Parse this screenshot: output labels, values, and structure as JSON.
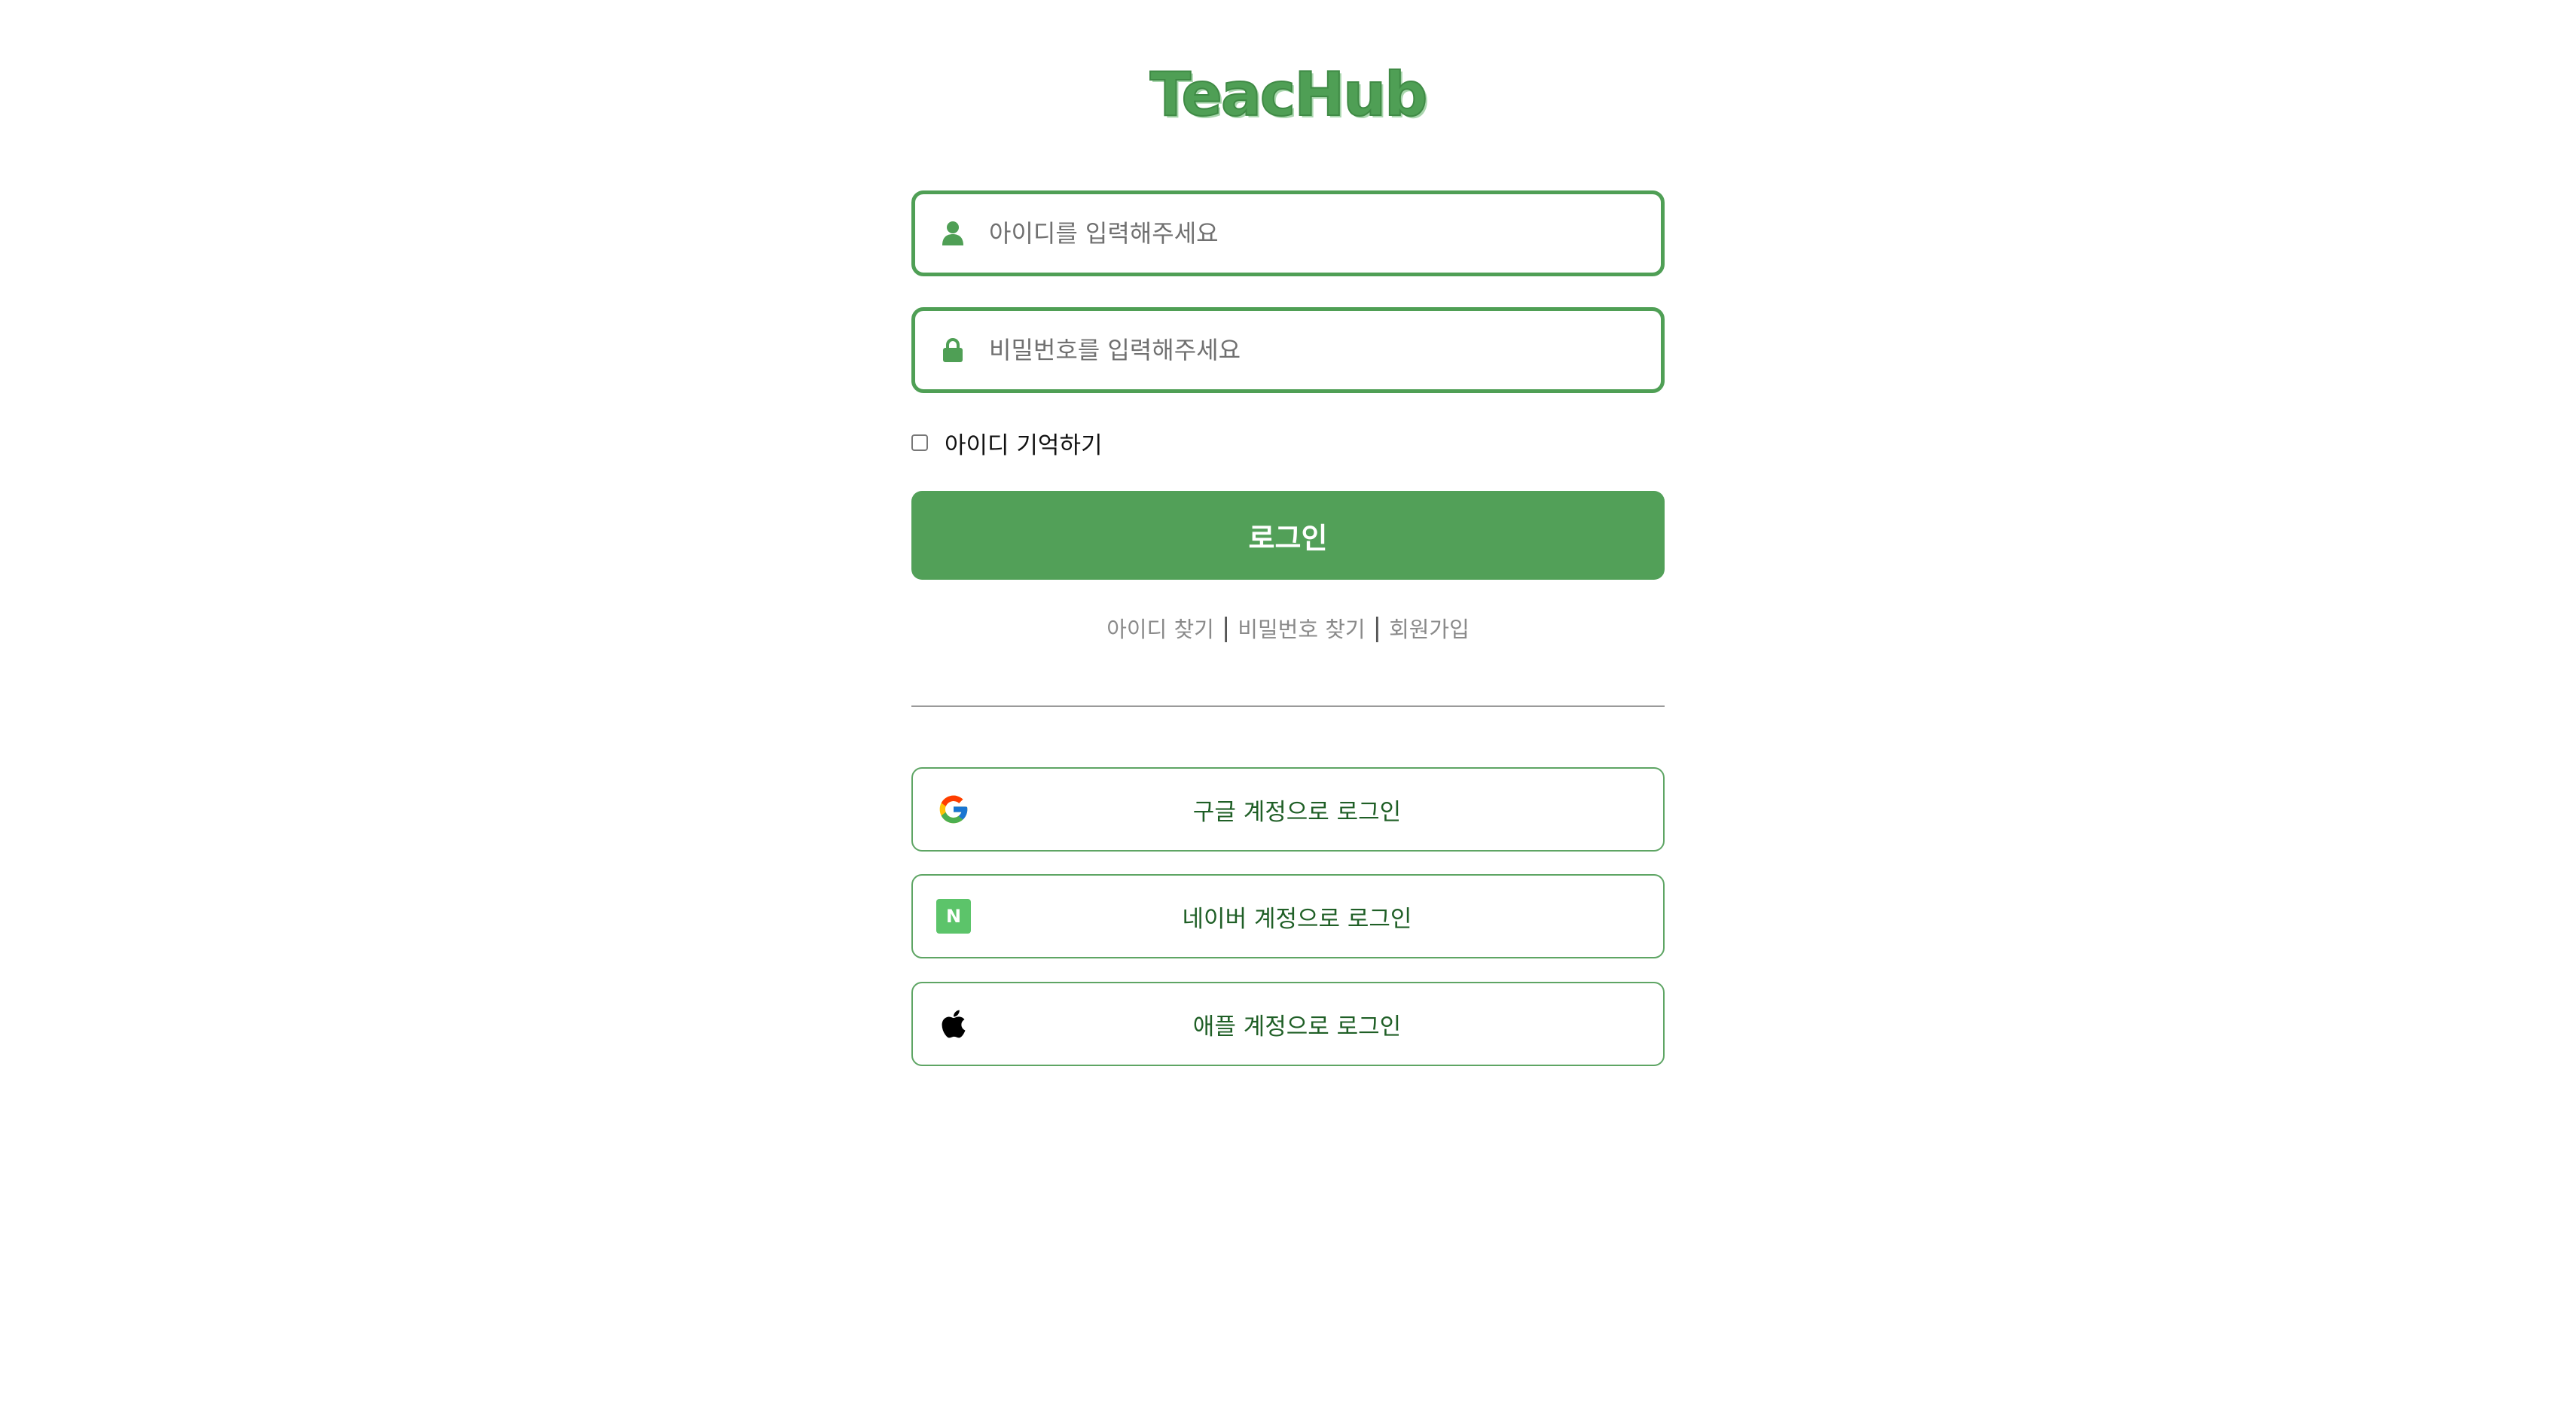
{
  "brand": {
    "logo_text": "TeacHub",
    "color": "#4f9f55"
  },
  "login_form": {
    "id_field": {
      "icon": "user-icon",
      "placeholder": "아이디를 입력해주세요",
      "value": ""
    },
    "password_field": {
      "icon": "lock-icon",
      "placeholder": "비밀번호를 입력해주세요",
      "value": ""
    },
    "remember_id": {
      "label": "아이디 기억하기",
      "checked": false
    },
    "login_button": "로그인"
  },
  "links": {
    "find_id": "아이디 찾기",
    "find_password": "비밀번호 찾기",
    "signup": "회원가입",
    "separator": "|"
  },
  "social_logins": {
    "google": {
      "label": "구글 계정으로 로그인",
      "icon": "google-icon"
    },
    "naver": {
      "label": "네이버 계정으로 로그인",
      "icon": "naver-icon",
      "icon_letter": "N"
    },
    "apple": {
      "label": "애플 계정으로 로그인",
      "icon": "apple-icon"
    }
  },
  "colors": {
    "primary": "#52a058",
    "border": "#4f9f55",
    "social_text": "#1f5f26",
    "naver": "#5cc46a"
  }
}
